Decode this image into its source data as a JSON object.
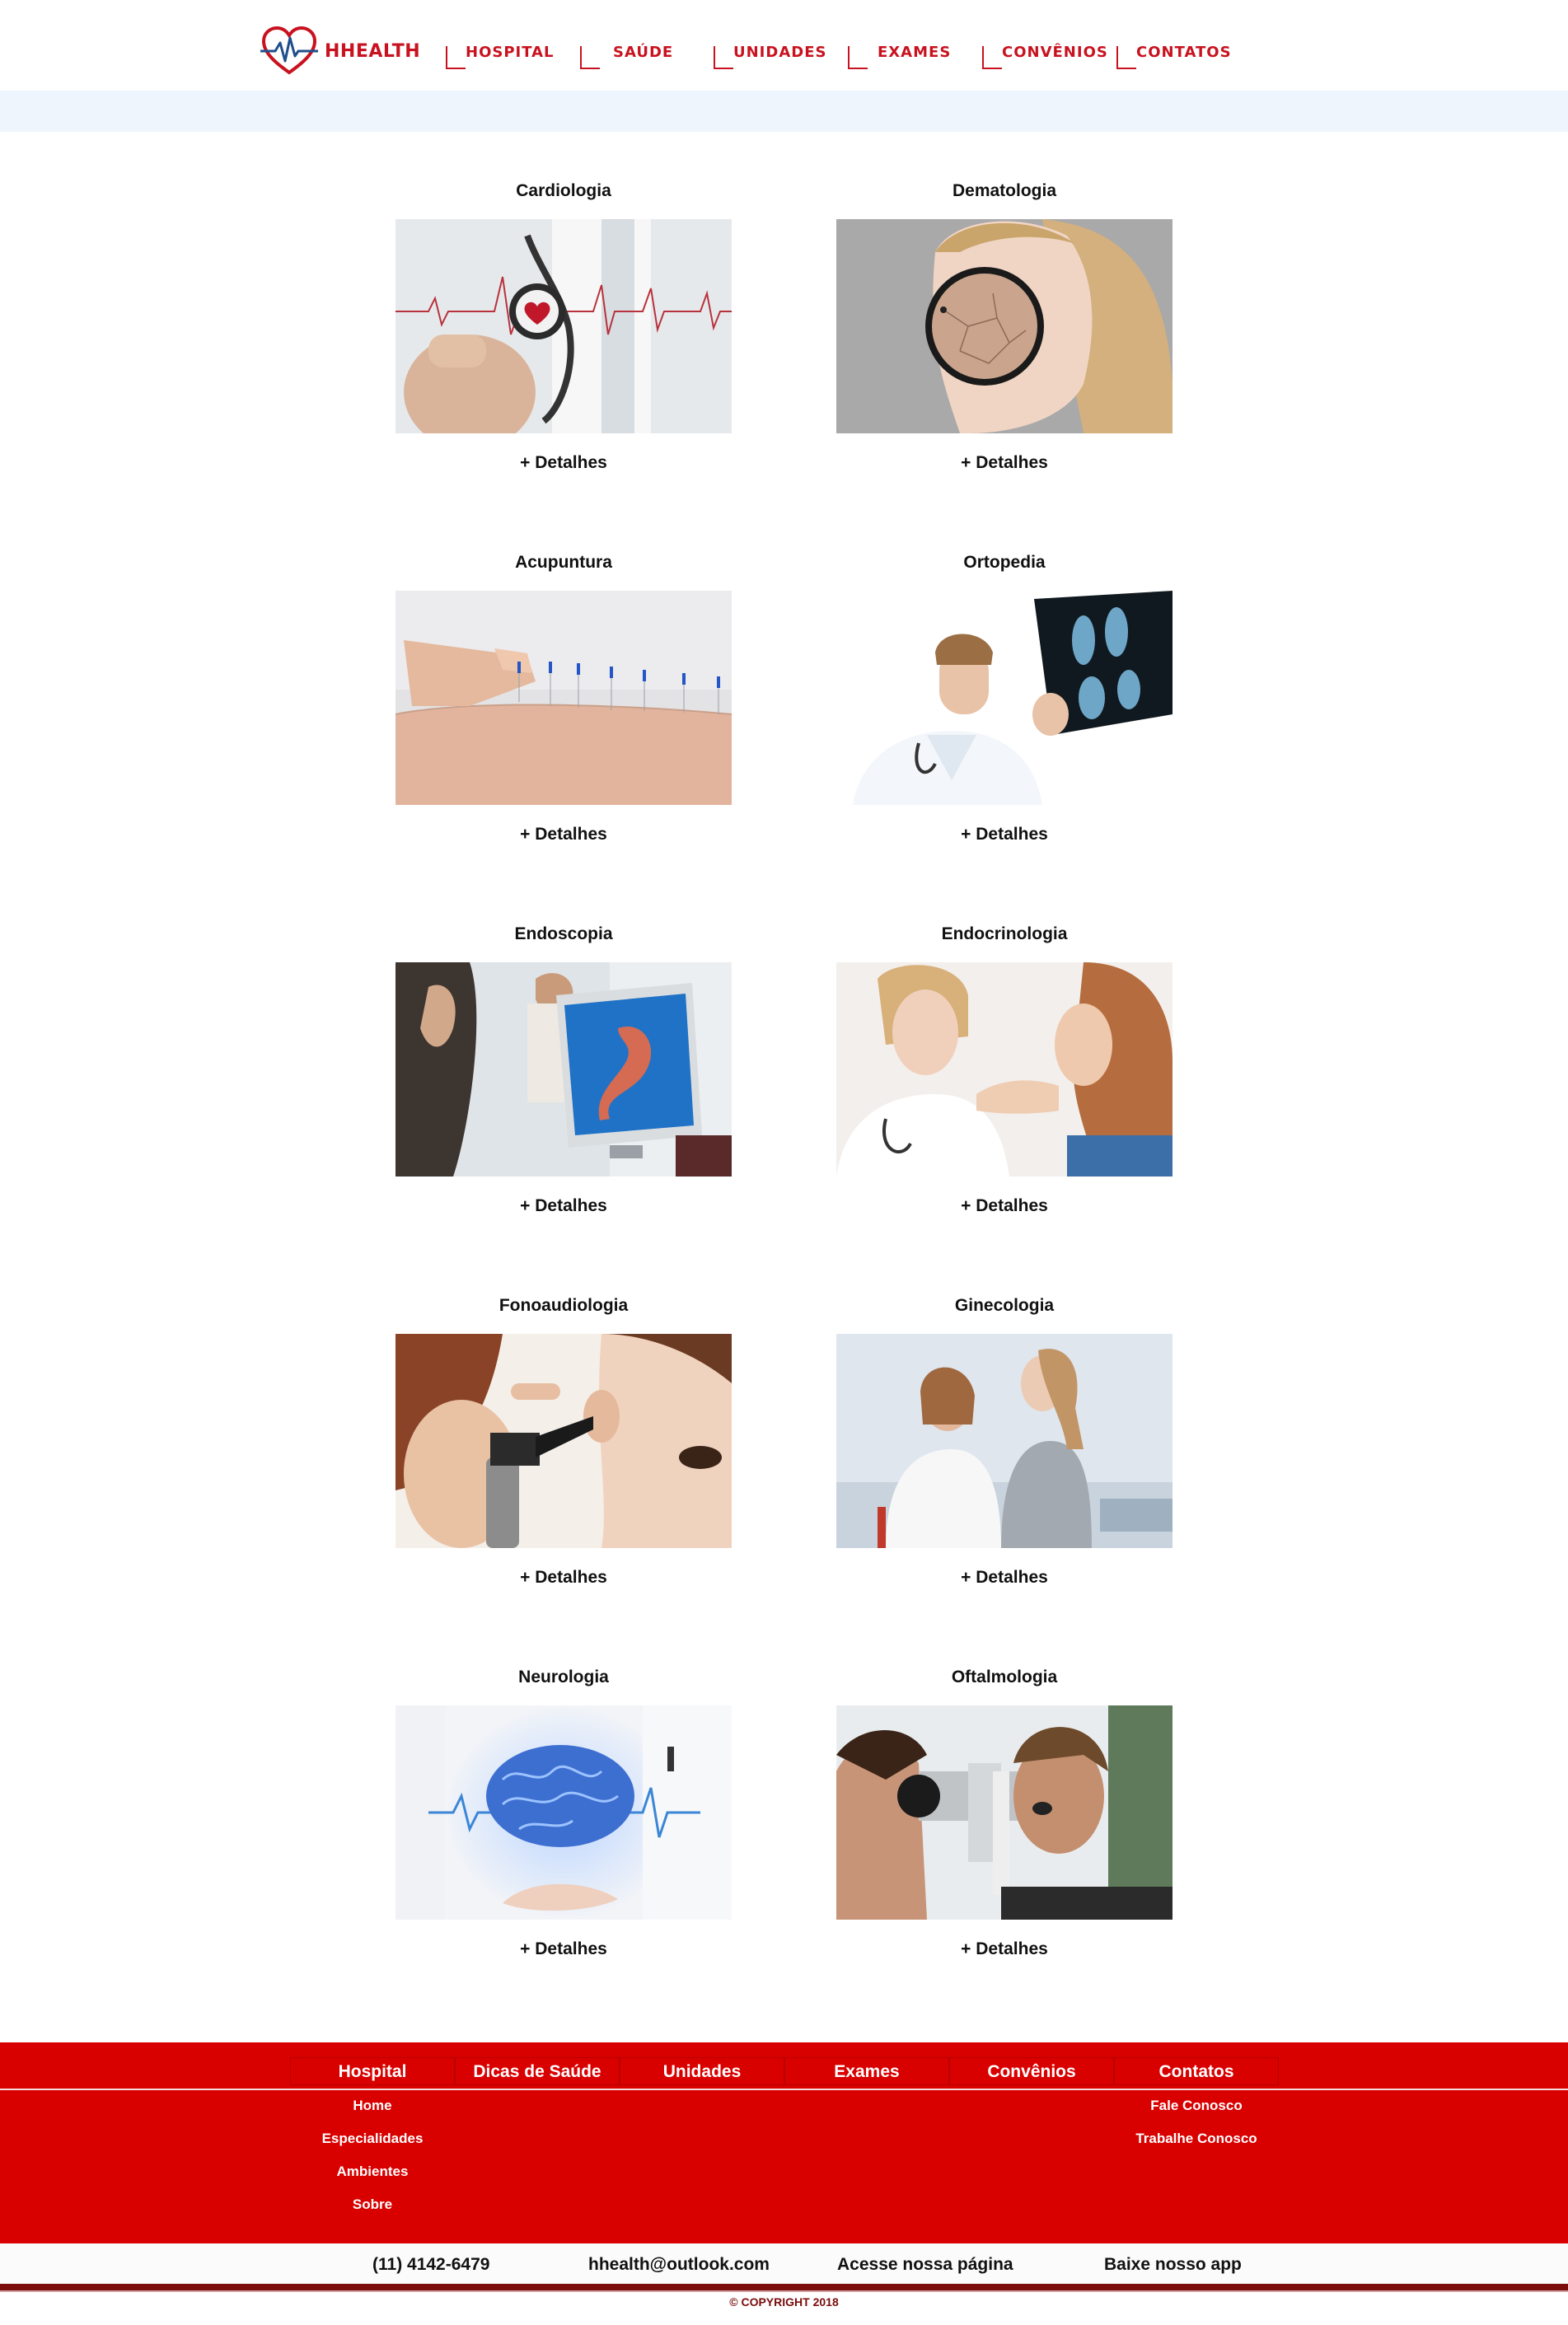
{
  "brand": {
    "name": "HHEALTH",
    "color": "#c8121f",
    "icon": "heart-pulse-icon"
  },
  "nav": [
    {
      "label": "HOSPITAL"
    },
    {
      "label": "SAÚDE"
    },
    {
      "label": "UNIDADES"
    },
    {
      "label": "EXAMES"
    },
    {
      "label": "CONVÊNIOS"
    },
    {
      "label": "CONTATOS"
    }
  ],
  "cards": [
    {
      "title": "Cardiologia",
      "link": "+ Detalhes",
      "image": "stethoscope-heart-photo"
    },
    {
      "title": "Dematologia",
      "link": "+ Detalhes",
      "image": "skin-magnifier-photo"
    },
    {
      "title": "Acupuntura",
      "link": "+ Detalhes",
      "image": "acupuncture-needles-photo"
    },
    {
      "title": "Ortopedia",
      "link": "+ Detalhes",
      "image": "doctor-xray-photo"
    },
    {
      "title": "Endoscopia",
      "link": "+ Detalhes",
      "image": "stomach-monitor-photo"
    },
    {
      "title": "Endocrinologia",
      "link": "+ Detalhes",
      "image": "thyroid-exam-photo"
    },
    {
      "title": "Fonoaudiologia",
      "link": "+ Detalhes",
      "image": "otoscope-ear-photo"
    },
    {
      "title": "Ginecologia",
      "link": "+ Detalhes",
      "image": "gynecology-consult-photo"
    },
    {
      "title": "Neurologia",
      "link": "+ Detalhes",
      "image": "brain-hologram-photo"
    },
    {
      "title": "Oftalmologia",
      "link": "+ Detalhes",
      "image": "eye-exam-photo"
    }
  ],
  "footer": {
    "columns": [
      {
        "title": "Hospital",
        "items": [
          "Home",
          "Especialidades",
          "Ambientes",
          "Sobre"
        ]
      },
      {
        "title": "Dicas de Saúde",
        "items": []
      },
      {
        "title": "Unidades",
        "items": []
      },
      {
        "title": "Exames",
        "items": []
      },
      {
        "title": "Convênios",
        "items": []
      },
      {
        "title": "Contatos",
        "items": [
          "Fale Conosco",
          "Trabalhe Conosco"
        ]
      }
    ],
    "phone": "(11) 4142-6479",
    "email": "hhealth@outlook.com",
    "page_link": "Acesse nossa página",
    "app_link": "Baixe nosso app",
    "copyright": "© COPYRIGHT 2018",
    "red": "#d90000",
    "dark_red": "#7a0c0c"
  }
}
